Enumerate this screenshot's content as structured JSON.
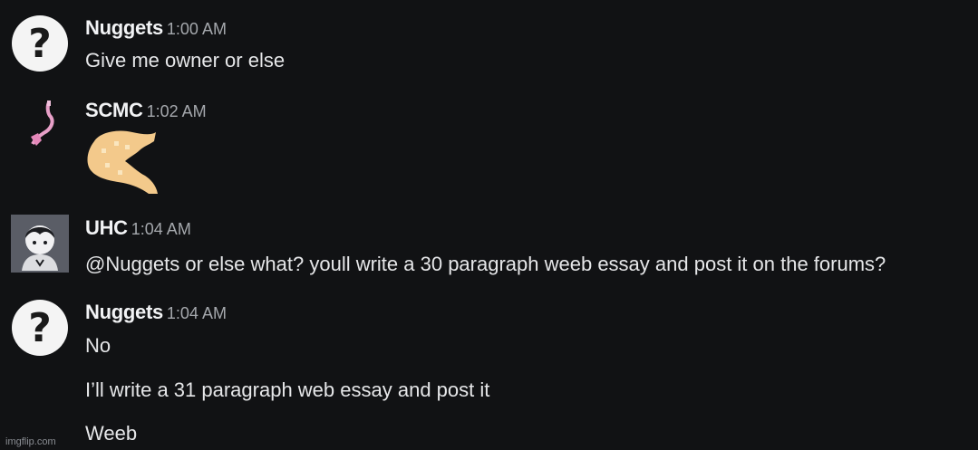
{
  "messages": [
    {
      "author": "Nuggets",
      "time": "1:00 AM",
      "avatar_icon": "question-mark-icon",
      "lines": [
        "Give me owner or else"
      ]
    },
    {
      "author": "SCMC",
      "time": "1:02 AM",
      "avatar_icon": "pink-hook-icon",
      "emoji": "yellow-ghost-emoji-icon"
    },
    {
      "author": "UHC",
      "time": "1:04 AM",
      "avatar_icon": "anime-character-avatar-icon",
      "lines": [
        "@Nuggets or else what? youll write a 30 paragraph weeb essay and post it on the forums?"
      ]
    },
    {
      "author": "Nuggets",
      "time": "1:04 AM",
      "avatar_icon": "question-mark-icon",
      "lines": [
        "No",
        "I’ll write a 31 paragraph web essay and post it",
        "Weeb"
      ]
    }
  ],
  "watermark": "imgflip.com",
  "colors": {
    "background": "#111214",
    "author": "#f2f3f5",
    "timestamp": "#a5a8ad",
    "text": "#e6e7e9"
  }
}
